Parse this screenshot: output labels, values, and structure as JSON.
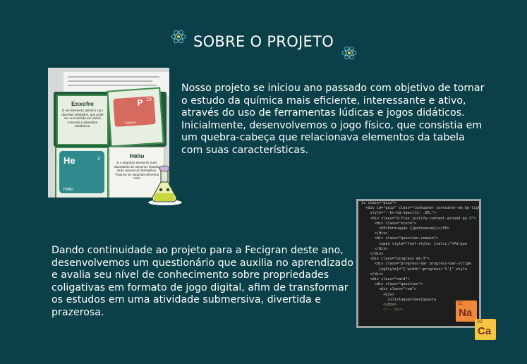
{
  "header": {
    "title": "SOBRE O PROJETO"
  },
  "intro": {
    "paragraph1": "Nosso projeto se iniciou ano passado com objetivo de tornar o estudo da química mais eficiente, interessante e ativo, através do uso de ferramentas lúdicas e jogos didáticos.",
    "paragraph2": "Inicialmente, desenvolvemos o jogo físico, que consistia em um quebra-cabeça que relacionava elementos da tabela com suas características."
  },
  "continuation": {
    "paragraph": "Dando continuidade ao projeto para a Fecigran deste ano, desenvolvemos um questionário que auxilia no aprendizado e avalia seu nível de conhecimento sobre propriedades coligativas em formato de jogo digital, afim de transformar os estudos em uma atividade submersiva, divertida e prazerosa."
  },
  "photo": {
    "card_enxofre_title": "Enxofre",
    "card_enxofre_text": "É um elemento químico com diversas utilidades, que pode ser encontrado em vários minerais e depósitos vulcânicos.",
    "card_p_symbol": "P",
    "card_p_number": "15",
    "card_p_name": "Fósforo",
    "card_he_symbol": "He",
    "card_he_number": "2",
    "card_he_name": "Hélio",
    "card_helio_title": "Hélio",
    "card_helio_text": "É o segundo elemento mais abundante do universo, ficando atrás apenas do hidrogênio. Trata-se do segundo elemento mais"
  },
  "code_lines": [
    "iv class=\"quiz\">",
    "  <div id=\"quiz\" class=\"container container-md bg-light",
    "    style=\"--bs-bg-opacity: .85;\">",
    "    <div class=\"d-flex justify-content-around py-3\">",
    "      <div class=\"score\">",
    "        <h5>Pontuação {{pontuacao}}</h5>",
    "      </div>",
    "      <div class=\"question-remain\">",
    "        <span style=\"font-style: italic;\">Pergun",
    "      </div>",
    "    </div>",
    "    <div class=\"progress mb-3\">",
    "      <div class=\"progress-bar progress-bar-stripe",
    "        [ngStyle]=\"{'width':progress+'%'}\" style",
    "    </div>",
    "    <div class=\"card\">",
    "      <div class=\"question\">",
    "        <div class=\"row\">",
    "          <div>",
    "            {{listaquestoes[questa",
    "          </div>",
    "          <!-- div>"
  ],
  "tiles": [
    {
      "number": "11",
      "symbol": "Na",
      "color": "#f08a3a"
    },
    {
      "number": "20",
      "symbol": "Ca",
      "color": "#f5c542"
    }
  ],
  "icons": [
    "atom-icon",
    "flask-icon"
  ]
}
